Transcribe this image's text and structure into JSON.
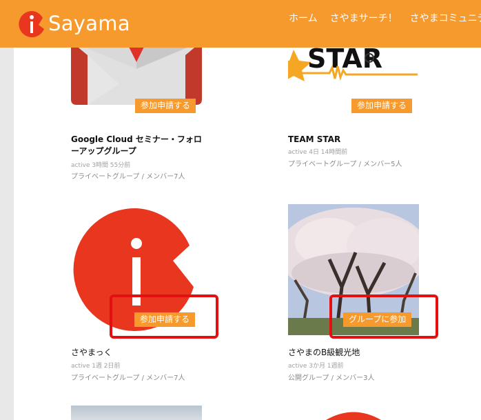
{
  "site": {
    "logo_text": "Sayama"
  },
  "nav": {
    "items": [
      "ホーム",
      "さやまサーチ！",
      "さやまコミュニティ"
    ]
  },
  "groups": [
    {
      "title": "Google Cloud セミナー・フォローアップグループ",
      "title_line1": "Google Cloud セミナー・フォロ",
      "title_line2": "ーアップグループ",
      "active": "active 3時間 55分前",
      "meta": "プライベートグループ / メンバー7人",
      "button": "参加申請する",
      "thumb_icon": "gmail-envelope-icon"
    },
    {
      "title": "TEAM STAR",
      "active": "active 4日 14時間前",
      "meta": "プライベートグループ / メンバー5人",
      "button": "参加申請する",
      "thumb_icon": "team-star-logo",
      "thumb_text": "STAR"
    },
    {
      "title": "さやまっく",
      "active": "active 1週 2日前",
      "meta": "プライベートグループ / メンバー7人",
      "button": "参加申請する",
      "thumb_icon": "sayama-i-logo"
    },
    {
      "title": "さやまのB級観光地",
      "active": "active 3か月 1週前",
      "meta": "公開グループ / メンバー3人",
      "button": "グループに参加",
      "thumb_icon": "cherry-blossom-photo"
    }
  ],
  "colors": {
    "header": "#f79a2e",
    "button": "#f79a2e",
    "highlight": "#e41010",
    "logo_red": "#e8361f"
  }
}
